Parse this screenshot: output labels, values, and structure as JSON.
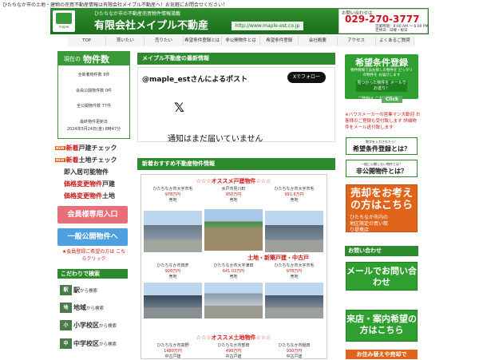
{
  "tagline": "ひたちなか市の土地・建物の売買不動産情報は有限会社メイプル不動産へ！お気軽にお問合せください！",
  "header": {
    "logo_text": "maple",
    "subtitle": "ひたちなか市の不動産売買物件情報満載",
    "company": "有限会社メイプル不動産",
    "url": "http://www.maple-est.co.jp"
  },
  "contact": {
    "label": "お問い合わせは",
    "phone": "029-270-3777",
    "hours": "営業時間：8:00 AM ～ 6:00 PM",
    "holiday": "定休日：日曜・祝日"
  },
  "nav": [
    "TOP",
    "買いたい",
    "売りたい",
    "希望条件登録とは",
    "非公開物件とは",
    "希望条件登録",
    "会社概要",
    "アクセス",
    "よくあるご質問"
  ],
  "count": {
    "pre": "現在の",
    "main": "物件数",
    "total": "全新着物件数 9件",
    "member": "会員公開物件数 0件",
    "all": "全公開物件数 77件",
    "updated_label": "最終物件更新日",
    "updated": "2024年5月24日(金) 8時47分"
  },
  "side_links": [
    {
      "badge": "NEW",
      "red": "新着",
      "rest": "戸建チェック"
    },
    {
      "badge": "NEW",
      "red": "新着",
      "rest": "土地チェック"
    },
    {
      "badge": "",
      "red": "",
      "rest": "即入居可能物件"
    },
    {
      "badge": "",
      "red": "価格変更物件",
      "rest": "戸建"
    },
    {
      "badge": "",
      "red": "価格変更物件",
      "rest": "土地"
    }
  ],
  "member_btn": "会員様専用入口",
  "public_btn": "一般公開物件へ",
  "member_note": "★会員登録ご希望の方は こちらクリック",
  "kodawari": {
    "title": "こだわりで検索",
    "items": [
      {
        "icon": "駅",
        "big": "駅",
        "small": "から検索"
      },
      {
        "icon": "地",
        "big": "地域",
        "small": "から検索"
      },
      {
        "icon": "小",
        "big": "小学校区",
        "small": "から検索"
      },
      {
        "icon": "中",
        "big": "中学校区",
        "small": "から検索"
      }
    ]
  },
  "latest": {
    "title": "メイプル不動産の最新情報",
    "tw_title": "@maple_estさんによるポスト",
    "tw_follow": "Xでフォロー",
    "tw_x": "𝕏",
    "tw_text": "通知はまだ届いていません"
  },
  "recommend": {
    "title": "新着おすすめ不動産物件情報",
    "house_banner": "☆☆☆オススメ戸建物件☆☆☆",
    "scroll_text": "土地・新築戸建・中古戸",
    "land_banner": "☆☆☆オススメ土地物件☆☆☆",
    "row1": [
      {
        "addr": "ひたちなか市大字市毛",
        "price": "978万円",
        "status": "売地"
      },
      {
        "addr": "水戸市見川町",
        "price": "950万円",
        "status": "売地"
      },
      {
        "addr": "ひたちなか市大字市毛",
        "price": "991.6万円",
        "status": "売地"
      }
    ],
    "row2": [
      {
        "addr": "ひたちなか市田彦",
        "price": "920万円",
        "status": "売地"
      },
      {
        "addr": "ひたちなか市大字津田",
        "price": "641.02万円",
        "status": "売地"
      },
      {
        "addr": "ひたちなか市大字市毛",
        "price": "978万円",
        "status": "売地"
      }
    ],
    "row3": [
      {
        "addr": "ひたちなか市高野",
        "price": "1480万円",
        "status": "中古戸建"
      },
      {
        "addr": "ひたちなか市部田",
        "price": "490万円",
        "status": "中古戸建"
      },
      {
        "addr": "ひたちなか市稲田",
        "price": "930万円",
        "status": "中古戸建"
      }
    ]
  },
  "right": {
    "reg_title": "希望条件登録",
    "reg_desc": "物件情報ではお探しの物件を ピッタリの物件を お届けします",
    "reg_sub": "見つかった物件を メールでお送り！",
    "reg_go": "ご登録は こちら",
    "reg_click": "Click",
    "note": "※ハウスメーカーの営業マン大歓迎 お客様のご登録も受付致します 詳細物件をメール送付致します",
    "btn1_small": "数字を入力されたら！",
    "btn1_big": "希望条件登録とは？",
    "btn2_small": "一般に公開しない物件とは？",
    "btn2_big": "非公開物件とは？",
    "sell": "売却をお考えの方はこちら",
    "sell_desc": "ひたちなか市内の地区限定の買い取り提携店",
    "inq_title": "お問い合わせ",
    "mail": "メールでお問い合わせ",
    "visit": "来店・案内希望の方はこちら",
    "bottom": "お住み替えや売却で"
  }
}
